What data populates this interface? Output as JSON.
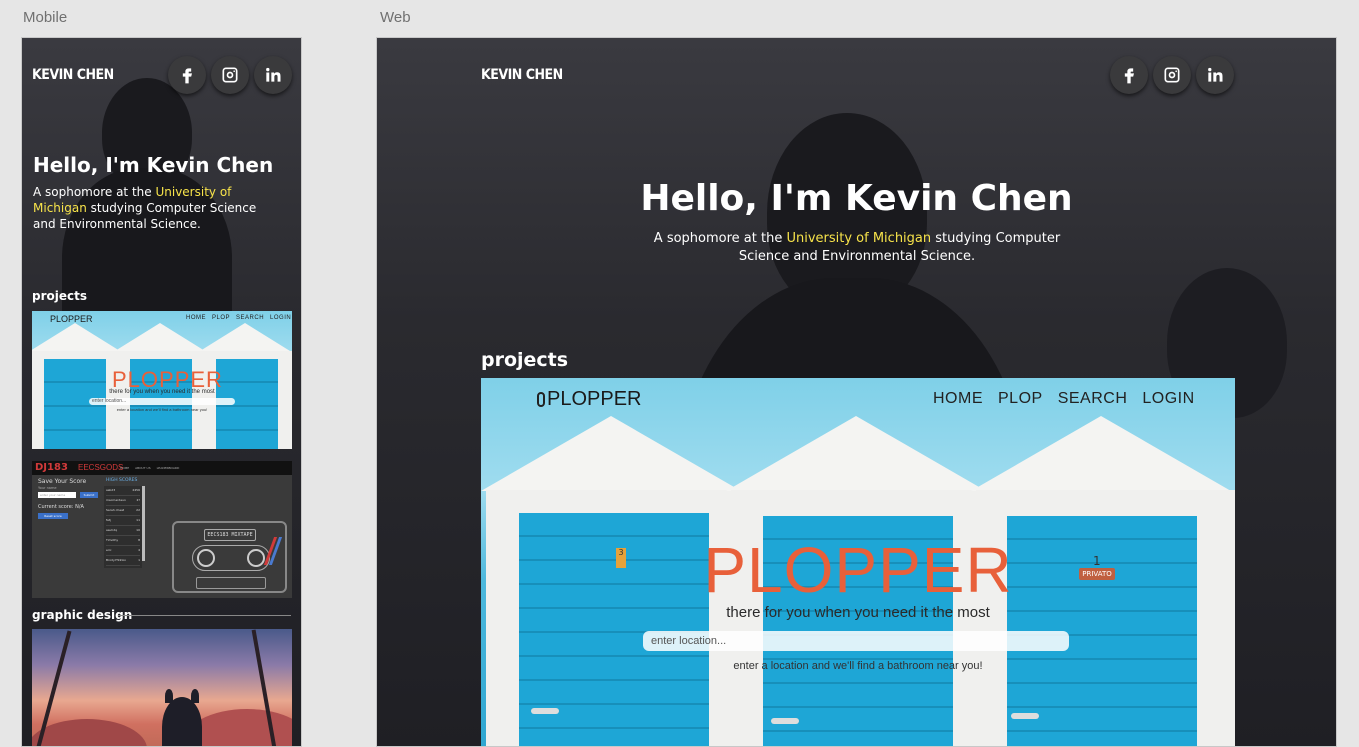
{
  "artboards": {
    "mobile_label": "Mobile",
    "web_label": "Web"
  },
  "site": {
    "brand": "KEVIN CHEN",
    "social": [
      {
        "name": "facebook",
        "icon": "facebook-icon"
      },
      {
        "name": "instagram",
        "icon": "instagram-icon"
      },
      {
        "name": "linkedin",
        "icon": "linkedin-icon"
      }
    ],
    "hello": "Hello, I'm Kevin Chen",
    "intro_before": "A sophomore at the ",
    "intro_highlight": "University of Michigan",
    "intro_after": " studying Computer Science and Environmental Science.",
    "projects_title": "projects",
    "graphic_design_title": "graphic design",
    "highlight_color": "#f7e34a"
  },
  "plopper": {
    "logo": "PLOPPER",
    "nav": [
      "HOME",
      "PLOP",
      "SEARCH",
      "LOGIN"
    ],
    "title": "PLOPPER",
    "tagline": "there for you when you need it the most",
    "input_placeholder": "enter location...",
    "hint": "enter a location and we'll find a bathroom near you!",
    "door_badge": "PRIVATO",
    "door_number": "1",
    "door_number_left": "3",
    "accent_color": "#e8603a"
  },
  "dj": {
    "logo": "DJ183",
    "brand": "EECSGODS",
    "nav": [
      "HOME",
      "ABOUT US",
      "LEADERBOARD"
    ],
    "save_title": "Save Your Score",
    "name_label": "Your name",
    "name_placeholder": "enter your name",
    "submit": "Submit",
    "current_score": "Current score: N/A",
    "reset_button": "Reset score",
    "high_scores_title": "HIGH SCORES",
    "scores": [
      {
        "name": "asbd3",
        "score": "2456"
      },
      {
        "name": "macmerdaun",
        "score": "2?"
      },
      {
        "name": "Sarah cheat",
        "score": "22"
      },
      {
        "name": "fatj",
        "score": "11"
      },
      {
        "name": "asuhdq",
        "score": "10"
      },
      {
        "name": "Timothy",
        "score": "8"
      },
      {
        "name": "eric",
        "score": "4"
      },
      {
        "name": "Brody7htlnko",
        "score": "1"
      }
    ],
    "cassette_label": "EECS183 MIXTAPE"
  }
}
